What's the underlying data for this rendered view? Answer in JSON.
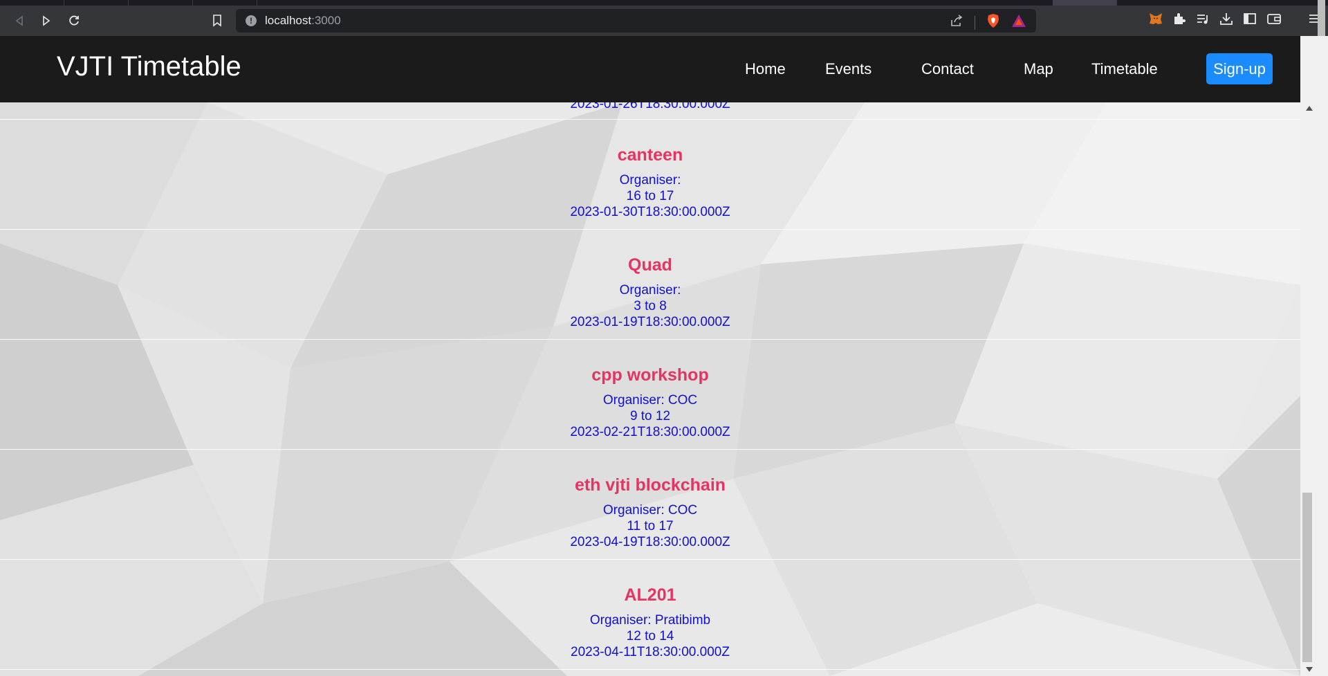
{
  "browser": {
    "url_host": "localhost",
    "url_port": ":3000",
    "icons": [
      "back-icon",
      "forward-icon",
      "reload-icon",
      "bookmark-icon",
      "site-info-icon",
      "share-icon",
      "brave-shield-icon",
      "brave-rewards-icon",
      "metamask-icon",
      "extensions-icon",
      "playlist-icon",
      "downloads-icon",
      "sidebar-icon",
      "wallet-icon",
      "menu-icon"
    ]
  },
  "navbar": {
    "brand": "VJTI Timetable",
    "links": [
      "Home",
      "Events",
      "Contact",
      "Map",
      "Timetable"
    ],
    "signup": "Sign-up"
  },
  "events": {
    "partial_prev": "2023-01-26T18:30:00.000Z",
    "items": [
      {
        "title": "canteen",
        "organiser": "Organiser:",
        "time": "16 to 17",
        "date": "2023-01-30T18:30:00.000Z"
      },
      {
        "title": "Quad",
        "organiser": "Organiser:",
        "time": "3 to 8",
        "date": "2023-01-19T18:30:00.000Z"
      },
      {
        "title": "cpp workshop",
        "organiser": "Organiser: COC",
        "time": "9 to 12",
        "date": "2023-02-21T18:30:00.000Z"
      },
      {
        "title": "eth vjti blockchain",
        "organiser": "Organiser: COC",
        "time": "11 to 17",
        "date": "2023-04-19T18:30:00.000Z"
      },
      {
        "title": "AL201",
        "organiser": "Organiser: Pratibimb",
        "time": "12 to 14",
        "date": "2023-04-11T18:30:00.000Z"
      }
    ]
  },
  "colors": {
    "navbar_bg": "#1b1b1b",
    "title": "#e63462",
    "detail": "#1010d0",
    "signup_bg": "#1a8cff"
  }
}
